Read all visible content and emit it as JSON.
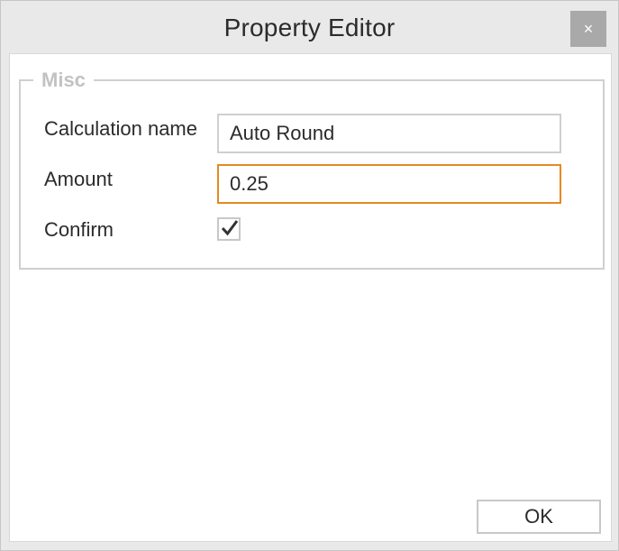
{
  "window": {
    "title": "Property Editor",
    "close_symbol": "×"
  },
  "group": {
    "legend": "Misc",
    "fields": {
      "calculation_name": {
        "label": "Calculation name",
        "value": "Auto Round"
      },
      "amount": {
        "label": "Amount",
        "value": "0.25"
      },
      "confirm": {
        "label": "Confirm",
        "checked": true
      }
    }
  },
  "buttons": {
    "ok_label": "OK"
  },
  "colors": {
    "focus_border": "#e58a1f",
    "close_button_bg": "#a9a9a9",
    "legend_text": "#c2c2c2"
  },
  "icons": {
    "close": "close-icon",
    "check": "checkmark-icon"
  }
}
